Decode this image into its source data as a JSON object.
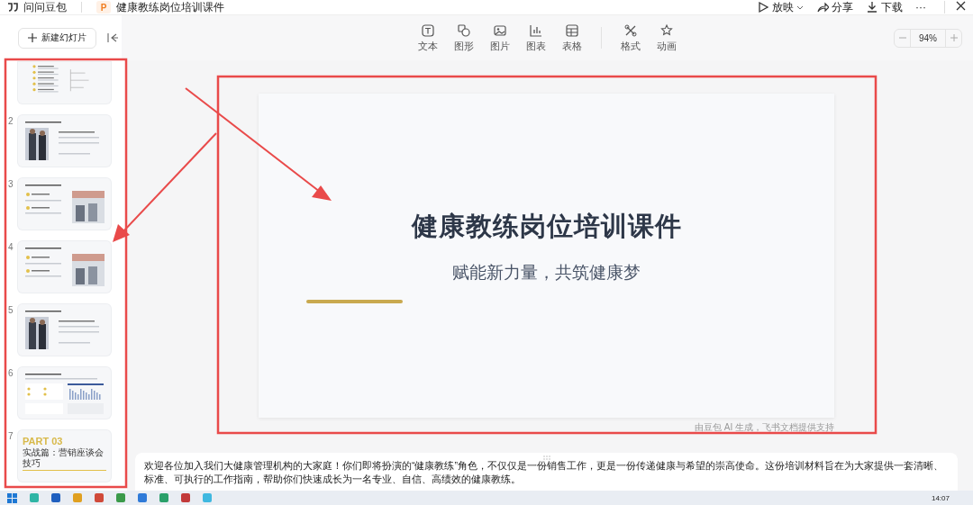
{
  "titlebar": {
    "assistant": "问问豆包",
    "file_badge": "P",
    "document_title": "健康教练岗位培训课件",
    "actions": [
      {
        "kind": "present",
        "label": "放映"
      },
      {
        "kind": "share",
        "label": "分享"
      },
      {
        "kind": "download",
        "label": "下载"
      },
      {
        "kind": "more",
        "label": "···"
      }
    ]
  },
  "sidebar": {
    "new_slide": "新建幻灯片",
    "slides": [
      {
        "kind": "cut"
      },
      {
        "kind": "full",
        "number": "2"
      },
      {
        "kind": "full",
        "number": "3"
      },
      {
        "kind": "full",
        "number": "4"
      },
      {
        "kind": "full",
        "number": "5"
      },
      {
        "kind": "full",
        "number": "6"
      },
      {
        "kind": "full",
        "number": "7",
        "part": "PART 03",
        "heading": "实战篇：营销座谈会技巧"
      }
    ]
  },
  "toolbar": {
    "groups": [
      [
        {
          "label": "文本"
        },
        {
          "label": "图形"
        },
        {
          "label": "图片"
        },
        {
          "label": "图表"
        },
        {
          "label": "表格"
        }
      ],
      [
        {
          "label": "格式"
        },
        {
          "label": "动画"
        }
      ]
    ],
    "zoom": "94%"
  },
  "slide": {
    "title": "健康教练岗位培训课件",
    "subtitle": "赋能新力量，共筑健康梦",
    "credit": "由豆包 AI 生成，飞书文档提供支持"
  },
  "notes": "欢迎各位加入我们大健康管理机构的大家庭！你们即将扮演的“健康教练”角色，不仅仅是一份销售工作，更是一份传递健康与希望的崇高使命。这份培训材料旨在为大家提供一套清晰、标准、可执行的工作指南，帮助你们快速成长为一名专业、自信、高绩效的健康教练。",
  "taskbar": {
    "time": "14:07"
  }
}
